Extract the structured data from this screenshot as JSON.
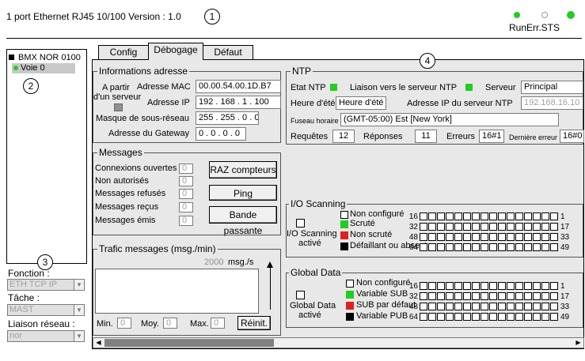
{
  "header": {
    "title": "1 port Ethernet RJ45 10/100  Version : 1.0",
    "status_label": "RunErr.STS",
    "callouts": [
      "1",
      "2",
      "3",
      "4"
    ]
  },
  "tree": {
    "module": "BMX NOR 0100",
    "channel": "Voie 0"
  },
  "left_panel": {
    "function_label": "Fonction :",
    "function_value": "ETH TCP IP",
    "task_label": "Tâche :",
    "task_value": "MAST",
    "network_label": "Liaison réseau :",
    "network_value": "nor"
  },
  "tabs": [
    "Config",
    "Débogage",
    "Défaut"
  ],
  "address_info": {
    "title": "Informations adresse",
    "from_server_line1": "A partir",
    "from_server_line2": "d'un serveur",
    "mac_label": "Adresse MAC",
    "mac_value": "00.00.54.00.1D.B7",
    "ip_label": "Adresse IP",
    "ip_value": "192 . 168 . 1 . 100",
    "mask_label": "Masque de sous-réseau",
    "mask_value": "255 . 255 . 0 . 0",
    "gateway_label": "Adresse du Gateway",
    "gateway_value": "0 . 0 . 0 . 0"
  },
  "messages": {
    "title": "Messages",
    "open_conn": "Connexions ouvertes",
    "unauthorized": "Non autorisés",
    "refused": "Messages refusés",
    "received": "Messages reçus",
    "sent": "Messages émis",
    "values": [
      "0",
      "0",
      "0",
      "0",
      "0"
    ],
    "reset_btn": "RAZ compteurs",
    "ping_btn": "Ping",
    "bandwidth_btn": "Bande passante"
  },
  "traffic": {
    "title": "Trafic messages (msg./min)",
    "scale_value": "2000",
    "scale_unit": "msg./s",
    "min_label": "Min.",
    "min_value": "0",
    "avg_label": "Moy.",
    "avg_value": "0",
    "max_label": "Max.",
    "max_value": "0",
    "reset_btn": "Réinit."
  },
  "ntp": {
    "title": "NTP",
    "state_label": "Etat NTP",
    "link_label": "Liaison vers le serveur NTP",
    "server_label": "Serveur",
    "server_value": "Principal",
    "summer_label": "Heure d'été",
    "summer_value": "Heure d'été",
    "ntp_ip_label": "Adresse IP du serveur NTP",
    "ntp_ip_value": "192.168.16.10",
    "tz_label": "Fuseau horaire",
    "tz_value": "(GMT-05:00) Est [New York]",
    "requests_label": "Requêtes",
    "requests_value": "12",
    "responses_label": "Réponses",
    "responses_value": "11",
    "errors_label": "Erreurs",
    "errors_value": "16#1",
    "last_error_label": "Dernière erreur",
    "last_error_value": "16#0"
  },
  "io_scanning": {
    "title": "I/O Scanning",
    "active_line1": "I/O Scanning",
    "active_line2": "activé",
    "legend": [
      "Non configuré",
      "Scruté",
      "Non scruté",
      "Défaillant ou absent"
    ],
    "row_left": [
      "16",
      "32",
      "48",
      "64"
    ],
    "row_right": [
      "1",
      "17",
      "33",
      "49"
    ]
  },
  "global_data": {
    "title": "Global Data",
    "active_line1": "Global Data",
    "active_line2": "activé",
    "legend": [
      "Non configuré",
      "Variable SUB",
      "SUB par défaut",
      "Variable PUB"
    ],
    "row_left": [
      "16",
      "32",
      "48",
      "64"
    ],
    "row_right": [
      "1",
      "17",
      "33",
      "49"
    ]
  },
  "colors": {
    "green": "#22cc22",
    "red": "#e02020",
    "black": "#000000",
    "panel": "#e8e8e8"
  }
}
